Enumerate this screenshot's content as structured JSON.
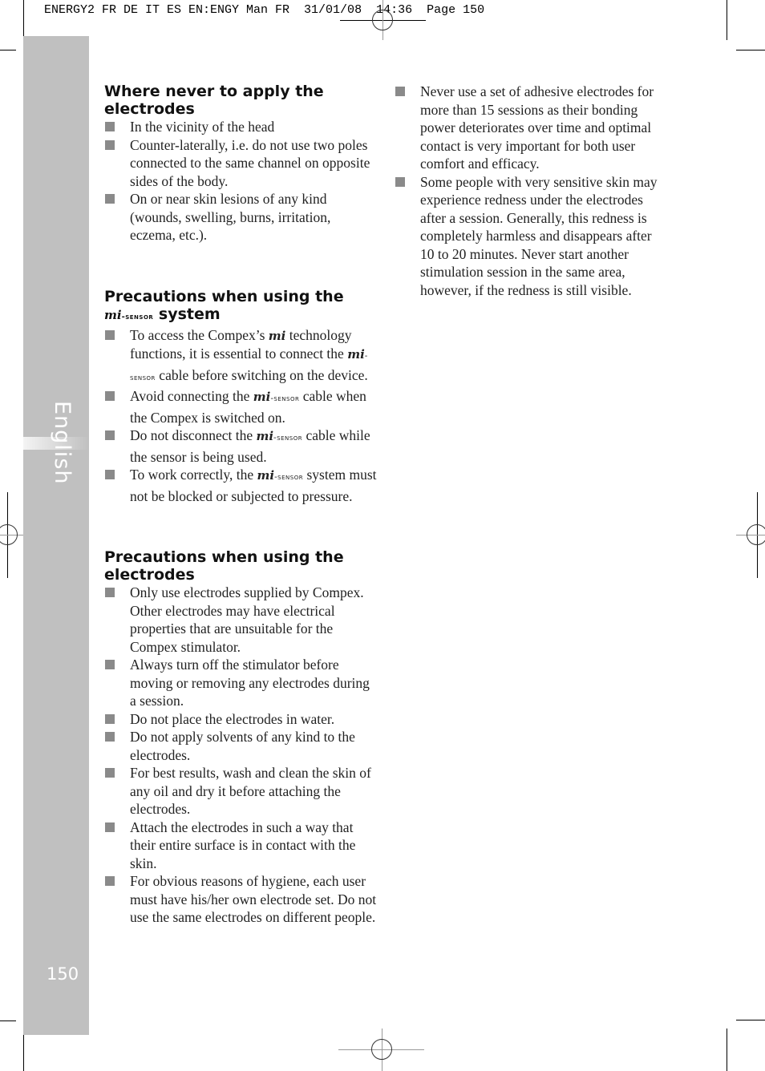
{
  "slug_line": "ENERGY2 FR DE IT ES EN:ENGY Man FR  31/01/08  14:36  Page 150",
  "sidebar": {
    "language_tab": "English",
    "page_number": "150"
  },
  "brand": {
    "mi": "mi",
    "sensor": "-sensor"
  },
  "left_column": {
    "section1": {
      "title_line1": "Where never to apply the",
      "title_line2": "electrodes",
      "items": [
        "In the vicinity of the head",
        "Counter-laterally, i.e. do not use two poles connected to the same channel on opposite sides of the body.",
        "On or near skin lesions of any kind (wounds, swelling, burns, irritation, eczema, etc.)."
      ]
    },
    "section2": {
      "title_line1": "Precautions when using the",
      "title_suffix": " system",
      "items": [
        {
          "a": "To access the Compex’s ",
          "b": " technology functions, it is essential to connect the ",
          "c": " cable before switching on the device."
        },
        {
          "a": "Avoid connecting the ",
          "b": " cable when the Compex is switched on."
        },
        {
          "a": "Do not disconnect the ",
          "b": " cable while the sensor is being used."
        },
        {
          "a": "To work correctly, the ",
          "b": " system must not be blocked or subjected to pressure."
        }
      ]
    },
    "section3": {
      "title_line1": "Precautions when using the",
      "title_line2": "electrodes",
      "items": [
        "Only use electrodes supplied by Compex. Other electrodes may have electrical properties that are unsuitable for the Compex stimulator.",
        "Always turn off the stimulator before moving or removing any electrodes during a session.",
        "Do not place the electrodes in water.",
        "Do not apply solvents of any kind to the electrodes.",
        "For best results, wash and clean the skin of any oil and dry it before attaching the electrodes.",
        "Attach the electrodes in such a way that their entire surface is in contact with the skin.",
        "For obvious reasons of hygiene, each user must have his/her own electrode set. Do not use the same electrodes on different people."
      ]
    }
  },
  "right_column": {
    "items": [
      "Never use a set of adhesive electrodes for more than 15 sessions as their bonding power deteriorates over time and optimal contact is very important for both user comfort and efficacy.",
      "Some people with very sensitive skin may experience redness under the electrodes after a session. Generally, this redness is completely harmless and disappears after 10 to 20 minutes. Never start another stimulation session in the same area, however, if the redness is still visible."
    ]
  }
}
